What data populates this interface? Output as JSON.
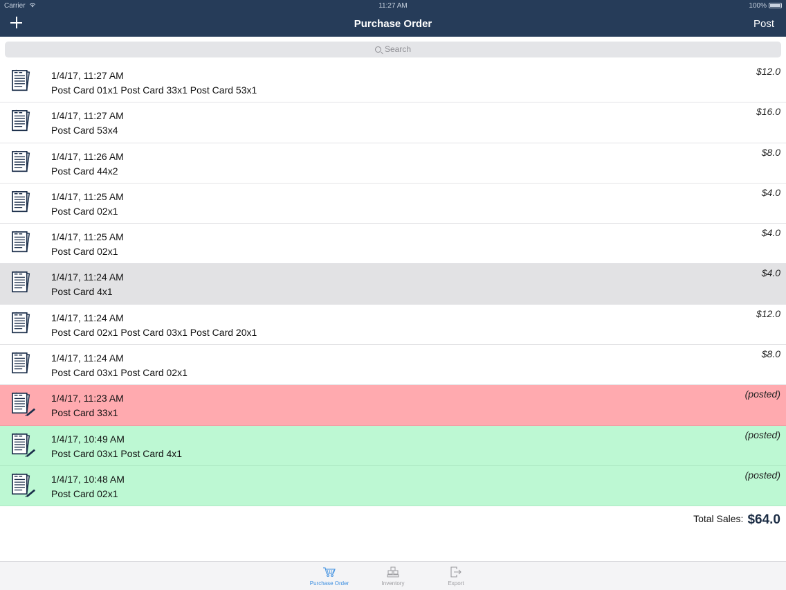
{
  "status_bar": {
    "carrier": "Carrier",
    "time": "11:27 AM",
    "battery": "100%"
  },
  "nav": {
    "title": "Purchase Order",
    "post_label": "Post",
    "add_icon": "plus-icon"
  },
  "search": {
    "placeholder": "Search"
  },
  "orders": [
    {
      "date": "1/4/17, 11:27 AM",
      "items": "Post Card 01x1 Post Card 33x1 Post Card 53x1",
      "amount": "$12.0",
      "state": "normal"
    },
    {
      "date": "1/4/17, 11:27 AM",
      "items": "Post Card 53x4",
      "amount": "$16.0",
      "state": "normal"
    },
    {
      "date": "1/4/17, 11:26 AM",
      "items": "Post Card 44x2",
      "amount": "$8.0",
      "state": "normal"
    },
    {
      "date": "1/4/17, 11:25 AM",
      "items": "Post Card 02x1",
      "amount": "$4.0",
      "state": "normal"
    },
    {
      "date": "1/4/17, 11:25 AM",
      "items": "Post Card 02x1",
      "amount": "$4.0",
      "state": "normal"
    },
    {
      "date": "1/4/17, 11:24 AM",
      "items": "Post Card 4x1",
      "amount": "$4.0",
      "state": "selected"
    },
    {
      "date": "1/4/17, 11:24 AM",
      "items": "Post Card 02x1 Post Card 03x1 Post Card 20x1",
      "amount": "$12.0",
      "state": "normal"
    },
    {
      "date": "1/4/17, 11:24 AM",
      "items": "Post Card 03x1 Post Card 02x1",
      "amount": "$8.0",
      "state": "normal"
    },
    {
      "date": "1/4/17, 11:23 AM",
      "items": "Post Card 33x1",
      "amount": "(posted)",
      "state": "posted-red"
    },
    {
      "date": "1/4/17, 10:49 AM",
      "items": "Post Card 03x1 Post Card 4x1",
      "amount": "(posted)",
      "state": "posted-green"
    },
    {
      "date": "1/4/17, 10:48 AM",
      "items": "Post Card 02x1",
      "amount": "(posted)",
      "state": "posted-green"
    }
  ],
  "total": {
    "label": "Total Sales:",
    "value": "$64.0"
  },
  "tabs": [
    {
      "label": "Purchase Order",
      "icon": "cart-icon",
      "active": true
    },
    {
      "label": "Inventory",
      "icon": "inventory-icon",
      "active": false
    },
    {
      "label": "Export",
      "icon": "export-icon",
      "active": false
    }
  ],
  "colors": {
    "nav": "#263c59",
    "selected": "#e2e2e4",
    "posted_red": "#ffaaaf",
    "posted_green": "#bdf8d3",
    "tab_active": "#3b8ee0"
  }
}
